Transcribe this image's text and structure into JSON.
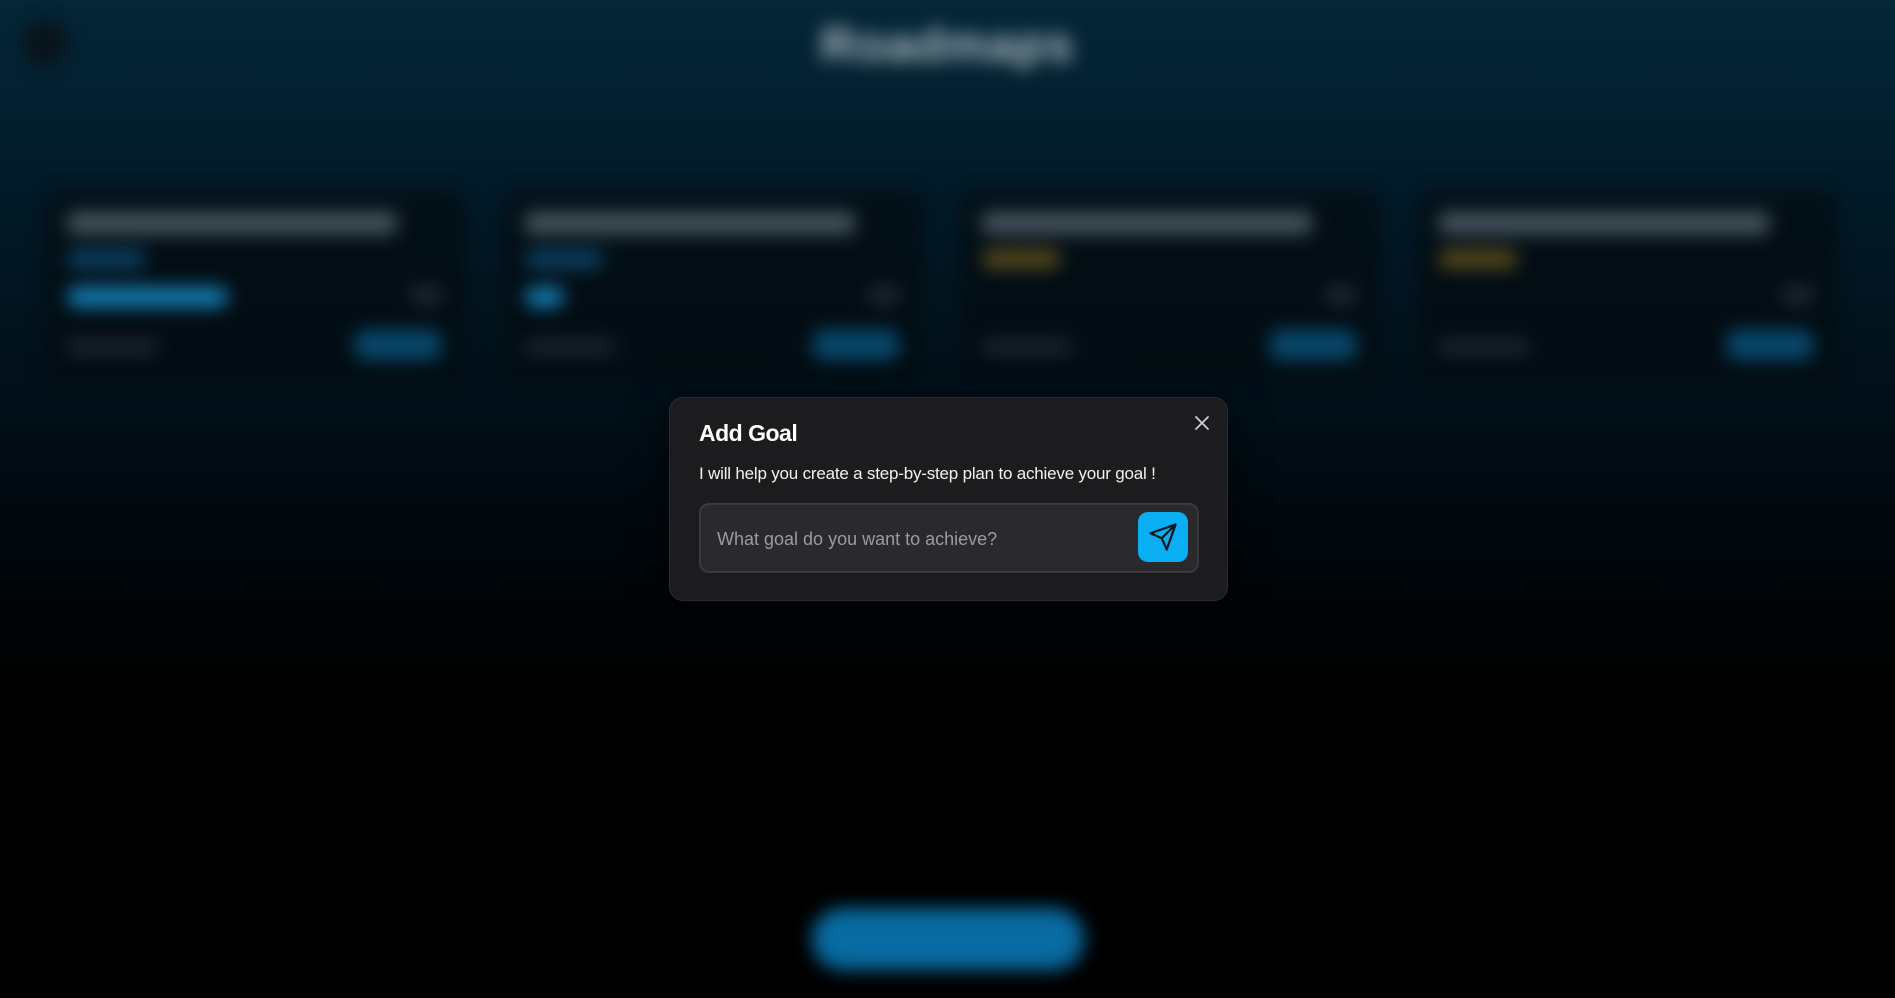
{
  "background": {
    "app_title": "Roadmaps",
    "subtitle": "",
    "cards": [
      {
        "tag_color": "#1a8fd6",
        "progress": 0.62
      },
      {
        "tag_color": "#1a8fd6",
        "progress": 0.15
      },
      {
        "tag_color": "#d9a520",
        "progress": 0
      },
      {
        "tag_color": "#d9a520",
        "progress": 0
      }
    ]
  },
  "modal": {
    "title": "Add Goal",
    "description": "I will help you create a step-by-step plan to achieve your goal !",
    "input": {
      "value": "",
      "placeholder": "What goal do you want to achieve?"
    },
    "close_icon": "close-icon",
    "send_icon": "send-icon"
  },
  "colors": {
    "accent": "#0aaef2",
    "modal_bg": "#1c1c1e"
  }
}
